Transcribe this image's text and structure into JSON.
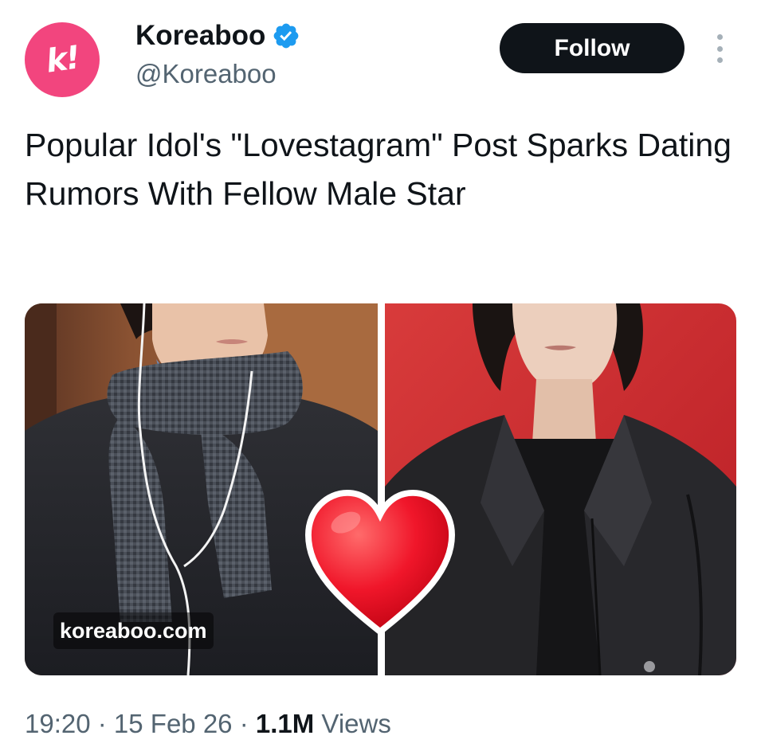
{
  "account": {
    "avatar_glyph": "k!",
    "avatar_color": "#f2457e",
    "display_name": "Koreaboo",
    "verified_icon": "verified-badge-icon",
    "verified_color": "#1d9bf0",
    "handle": "@Koreaboo"
  },
  "actions": {
    "follow_label": "Follow",
    "more_icon": "more-vertical-icon"
  },
  "tweet": {
    "text": "Popular Idol's \"Lovestagram\" Post Sparks Dating Rumors With Fellow Male Star"
  },
  "media": {
    "watermark": "koreaboo.com",
    "overlay_icon": "red-heart-icon"
  },
  "meta": {
    "time": "19:20",
    "sep1": " · ",
    "date": "15 Feb 26",
    "sep2": " · ",
    "views_count": "1.1M",
    "views_label": " Views"
  }
}
